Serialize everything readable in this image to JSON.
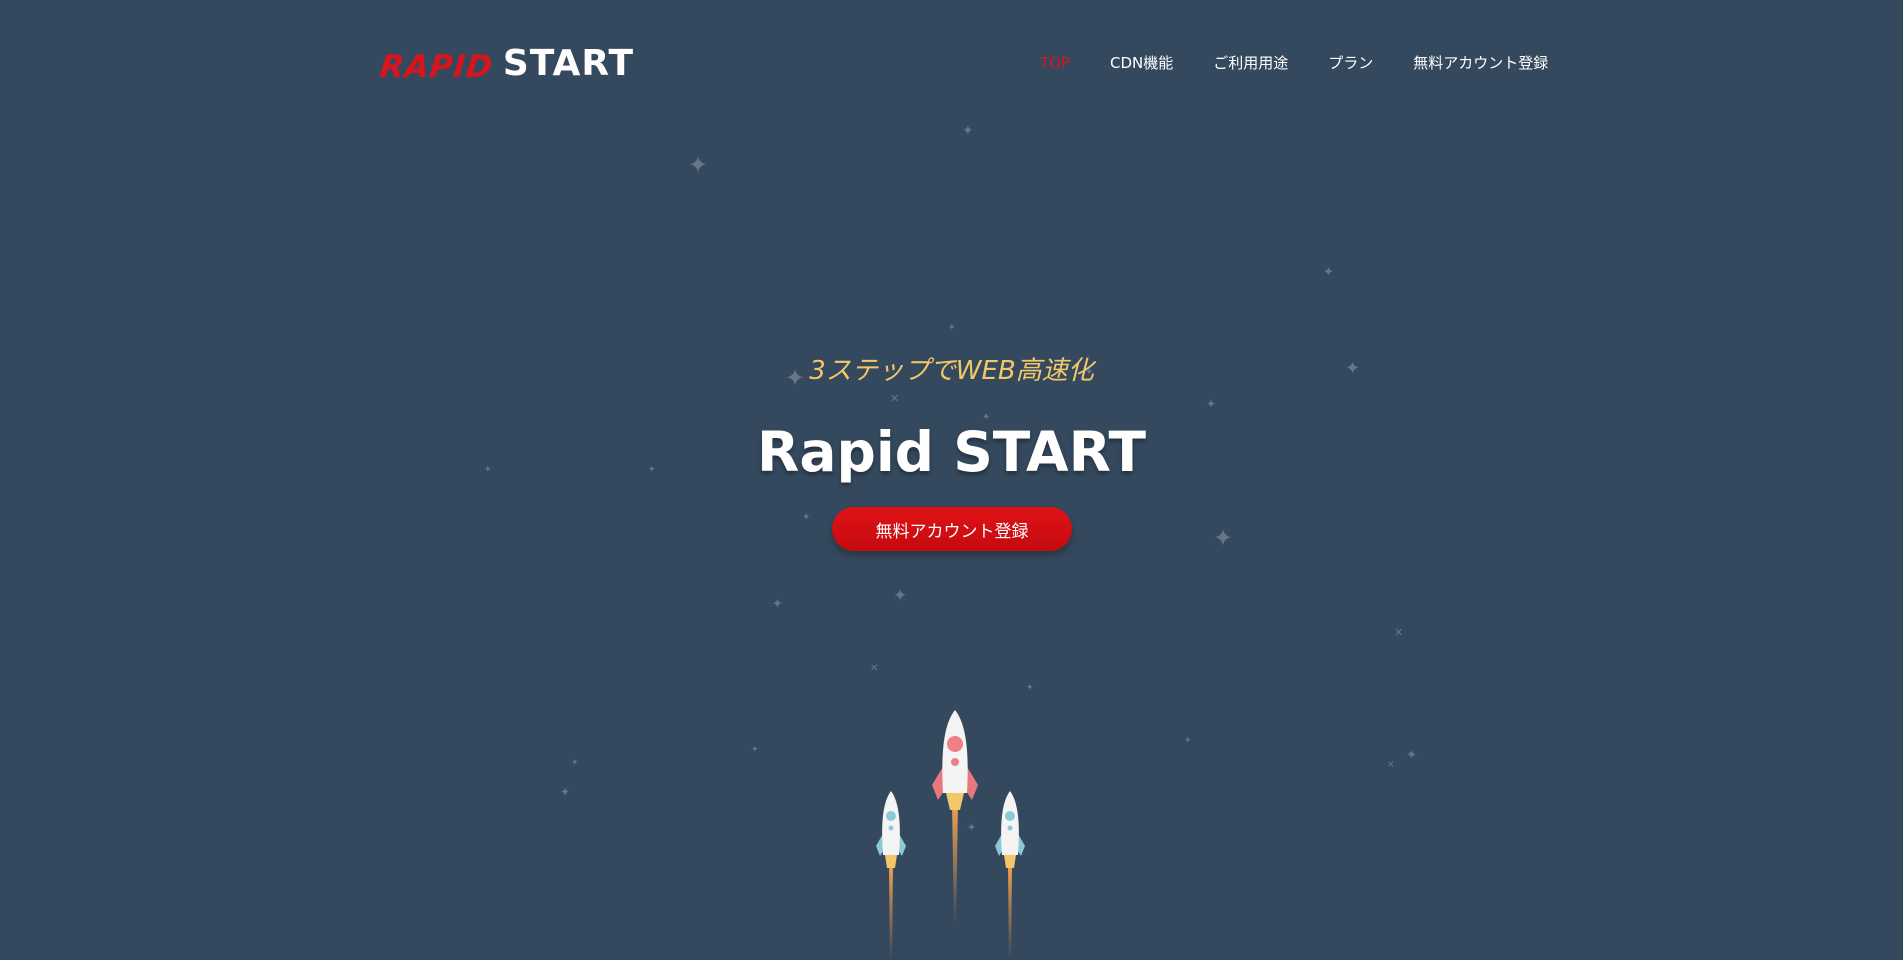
{
  "header": {
    "logo_part1": "RAPID",
    "logo_part2": "START",
    "nav": [
      {
        "label": "TOP",
        "active": true
      },
      {
        "label": "CDN機能",
        "active": false
      },
      {
        "label": "ご利用用途",
        "active": false
      },
      {
        "label": "プラン",
        "active": false
      },
      {
        "label": "無料アカウント登録",
        "active": false
      }
    ]
  },
  "hero": {
    "subtitle": "3ステップでWEB高速化",
    "title": "Rapid START",
    "cta_label": "無料アカウント登録"
  },
  "colors": {
    "background": "#35495e",
    "accent_red": "#d8141d",
    "subtitle_gold": "#f2c769",
    "star": "#6f7f92"
  },
  "icons": {
    "star": "sparkle-icon",
    "rocket": "rocket-icon"
  }
}
